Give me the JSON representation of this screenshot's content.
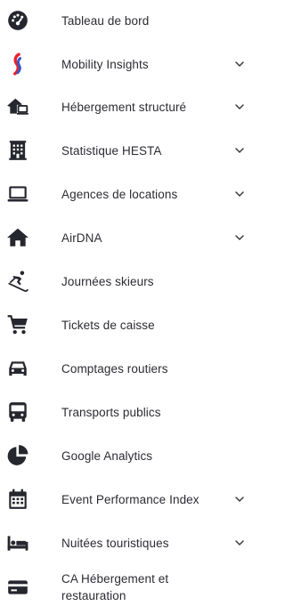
{
  "sidebar": {
    "items": [
      {
        "label": "Tableau de bord",
        "icon": "dashboard-gauge-icon",
        "expandable": false
      },
      {
        "label": "Mobility Insights",
        "icon": "mobility-insights-logo-icon",
        "expandable": true
      },
      {
        "label": "Hébergement structuré",
        "icon": "house-laptop-icon",
        "expandable": true
      },
      {
        "label": "Statistique HESTA",
        "icon": "hotel-building-icon",
        "expandable": true
      },
      {
        "label": "Agences de locations",
        "icon": "laptop-icon",
        "expandable": true
      },
      {
        "label": "AirDNA",
        "icon": "home-icon",
        "expandable": true
      },
      {
        "label": "Journées skieurs",
        "icon": "skier-icon",
        "expandable": false
      },
      {
        "label": "Tickets de caisse",
        "icon": "shopping-cart-icon",
        "expandable": false
      },
      {
        "label": "Comptages routiers",
        "icon": "car-icon",
        "expandable": false
      },
      {
        "label": "Transports publics",
        "icon": "bus-icon",
        "expandable": false
      },
      {
        "label": "Google Analytics",
        "icon": "pie-chart-icon",
        "expandable": false
      },
      {
        "label": "Event Performance Index",
        "icon": "calendar-icon",
        "expandable": true
      },
      {
        "label": "Nuitées touristiques",
        "icon": "bed-icon",
        "expandable": true
      },
      {
        "label": "CA Hébergement et restauration",
        "icon": "credit-card-icon",
        "expandable": false
      }
    ]
  },
  "colors": {
    "icon": "#26262e",
    "text": "#2b2b33",
    "chevron": "#3a3a42",
    "brand_red": "#e8232e",
    "brand_blue": "#2f57c8"
  }
}
